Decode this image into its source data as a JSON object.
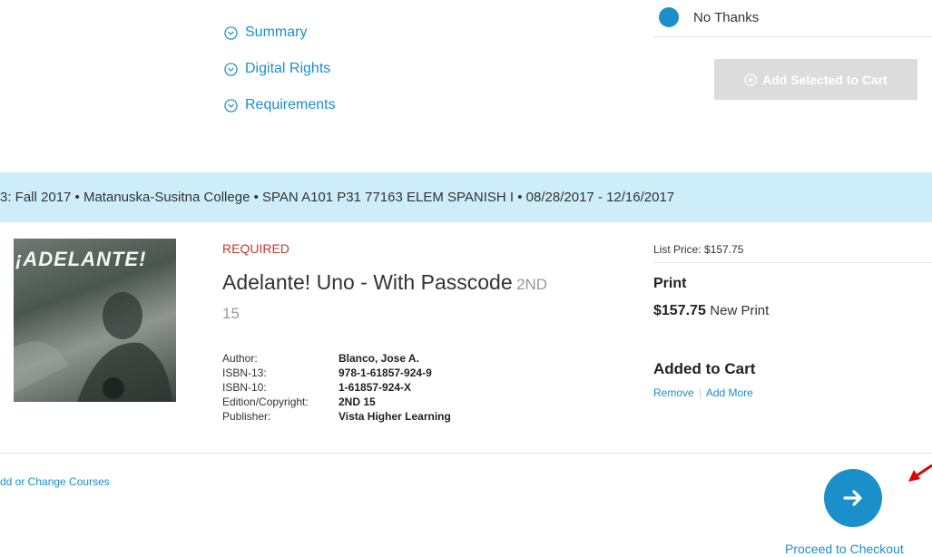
{
  "details_links": [
    {
      "label": "Summary"
    },
    {
      "label": "Digital Rights"
    },
    {
      "label": "Requirements"
    }
  ],
  "options": {
    "no_thanks_label": "No Thanks",
    "add_selected_label": "Add Selected to Cart"
  },
  "course_banner": {
    "text": "3: Fall 2017 • Matanuska-Susitna College • SPAN A101 P31 77163 ELEM SPANISH I • 08/28/2017 - 12/16/2017"
  },
  "book": {
    "cover_title": "¡ADELANTE!",
    "requirement": "REQUIRED",
    "title": "Adelante! Uno - With Passcode",
    "edition_suffix": "2ND",
    "edition_year": "15",
    "meta": [
      {
        "key": "Author:",
        "value": "Blanco, Jose A."
      },
      {
        "key": "ISBN-13:",
        "value": "978-1-61857-924-9"
      },
      {
        "key": "ISBN-10:",
        "value": "1-61857-924-X"
      },
      {
        "key": "Edition/Copyright:",
        "value": "2ND 15"
      },
      {
        "key": "Publisher:",
        "value": "Vista Higher Learning"
      }
    ]
  },
  "pricing": {
    "list_price": "List Price: $157.75",
    "format": "Print",
    "price": "$157.75",
    "price_type": "New Print",
    "status": "Added to Cart",
    "remove_label": "Remove",
    "separator": "|",
    "add_more_label": "Add More"
  },
  "footer": {
    "change_courses_label": "dd or Change Courses",
    "checkout_label": "Proceed to Checkout"
  },
  "colors": {
    "accent": "#1a8fc9",
    "banner": "#cdeef8",
    "required": "#c0392b",
    "annotation_arrow": "#e00000"
  }
}
